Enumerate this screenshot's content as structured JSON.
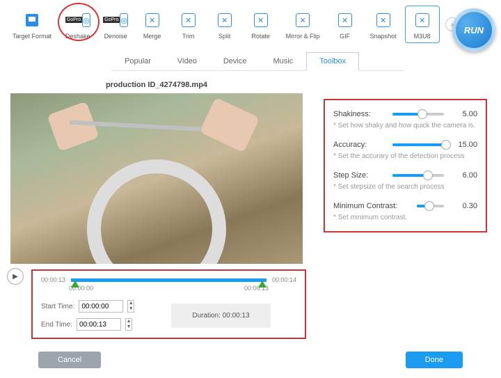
{
  "toolbar": {
    "target_format": "Target Format",
    "deshake": "Deshake",
    "denoise": "Denoise",
    "merge": "Merge",
    "trim": "Trim",
    "split": "Split",
    "rotate": "Rotate",
    "mirror_flip": "Mirror & Flip",
    "gif": "GIF",
    "snapshot": "Snapshot",
    "m3u8": "M3U8",
    "run": "RUN"
  },
  "tabs": {
    "popular": "Popular",
    "video": "Video",
    "device": "Device",
    "music": "Music",
    "toolbox": "Toolbox"
  },
  "file": {
    "name": "production ID_4274798.mp4"
  },
  "timeline": {
    "tick_start": "00:00:13",
    "tick_end": "00:00:14",
    "range_start": "00:00:00",
    "range_end": "00:00:13",
    "start_label": "Start Time:",
    "end_label": "End Time:",
    "start_value": "00:00:00",
    "end_value": "00:00:13",
    "duration_label": "Duration:  00:00:13"
  },
  "params": {
    "shakiness": {
      "label": "Shakiness:",
      "value": "5.00",
      "desc": "* Set how shaky and how quick the camera is.",
      "fill": 50,
      "thumb": 50
    },
    "accuracy": {
      "label": "Accuracy:",
      "value": "15.00",
      "desc": "* Set the accurary of the detection process",
      "fill": 100,
      "thumb": 98
    },
    "stepsize": {
      "label": "Step Size:",
      "value": "6.00",
      "desc": "* Set stepsize of the search process",
      "fill": 62,
      "thumb": 62
    },
    "contrast": {
      "label": "Minimum Contrast:",
      "value": "0.30",
      "desc": "* Set minimum contrast.",
      "fill": 30,
      "thumb": 30
    }
  },
  "buttons": {
    "cancel": "Cancel",
    "done": "Done"
  }
}
